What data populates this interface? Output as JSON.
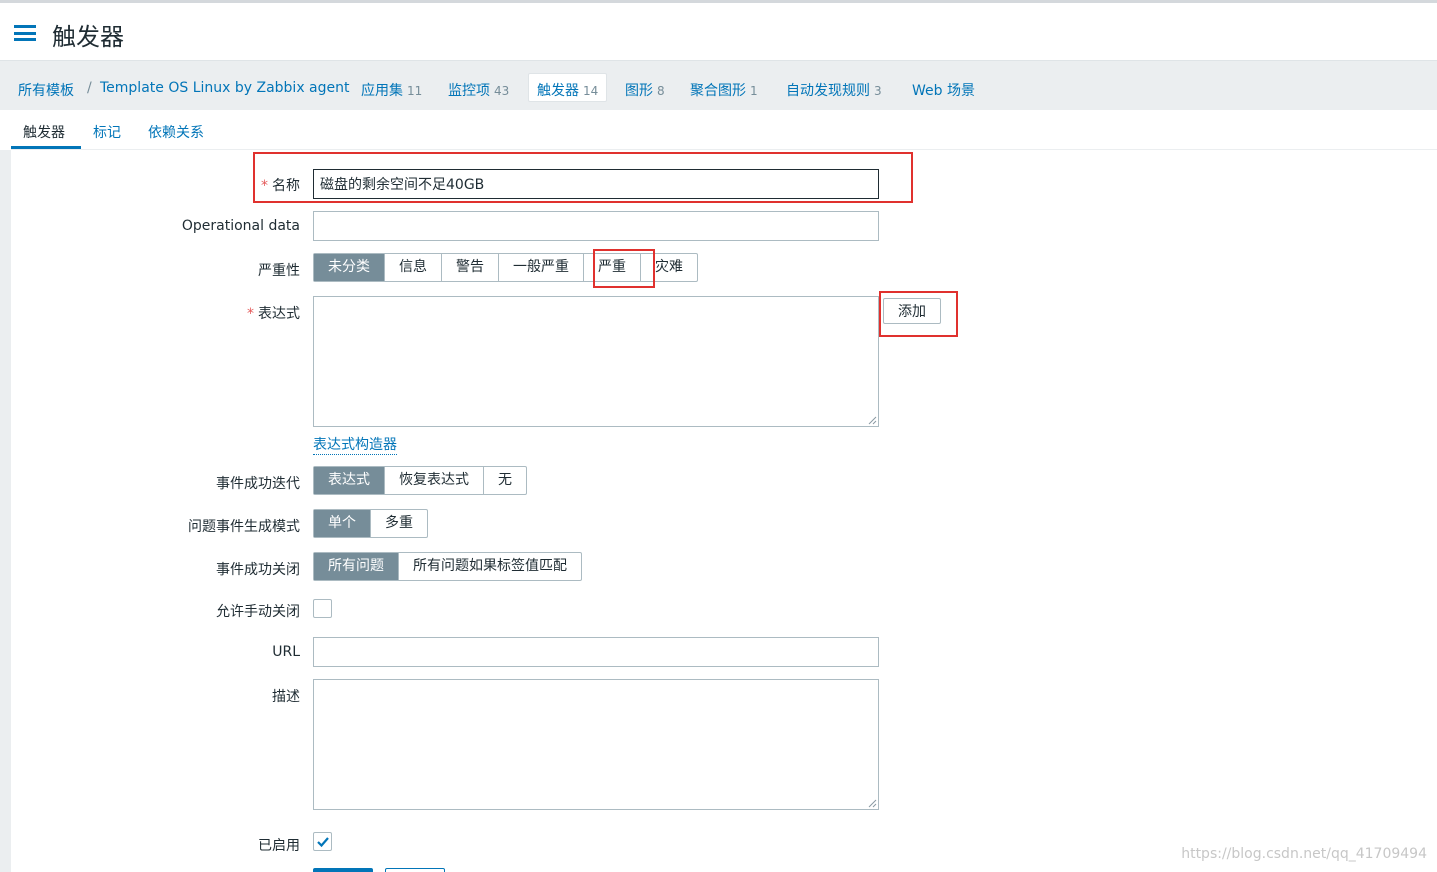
{
  "header": {
    "title": "触发器"
  },
  "breadcrumb": {
    "all_templates": "所有模板",
    "separator": "/",
    "template": "Template OS Linux by Zabbix agent",
    "items": [
      {
        "label": "应用集",
        "count": "11"
      },
      {
        "label": "监控项",
        "count": "43"
      },
      {
        "label": "触发器",
        "count": "14"
      },
      {
        "label": "图形",
        "count": "8"
      },
      {
        "label": "聚合图形",
        "count": "1"
      },
      {
        "label": "自动发现规则",
        "count": "3"
      },
      {
        "label": "Web 场景",
        "count": ""
      }
    ]
  },
  "tabs": [
    {
      "label": "触发器"
    },
    {
      "label": "标记"
    },
    {
      "label": "依赖关系"
    }
  ],
  "form": {
    "name_label": "名称",
    "name_value": "磁盘的剩余空间不足40GB",
    "operational_label": "Operational data",
    "operational_value": "",
    "severity_label": "严重性",
    "severity_options": [
      "未分类",
      "信息",
      "警告",
      "一般严重",
      "严重",
      "灾难"
    ],
    "severity_selected": "未分类",
    "expression_label": "表达式",
    "add_button": "添加",
    "expression_builder": "表达式构造器",
    "ok_event_label": "事件成功迭代",
    "ok_event_options": [
      "表达式",
      "恢复表达式",
      "无"
    ],
    "problem_mode_label": "问题事件生成模式",
    "problem_mode_options": [
      "单个",
      "多重"
    ],
    "ok_close_label": "事件成功关闭",
    "ok_close_options": [
      "所有问题",
      "所有问题如果标签值匹配"
    ],
    "manual_close_label": "允许手动关闭",
    "manual_close_checked": false,
    "url_label": "URL",
    "url_value": "",
    "description_label": "描述",
    "enabled_label": "已启用",
    "enabled_checked": true
  },
  "watermark": "https://blog.csdn.net/qq_41709494",
  "colors": {
    "link": "#0275b8",
    "selected_segment": "#768d99",
    "highlight": "#e0312e"
  }
}
